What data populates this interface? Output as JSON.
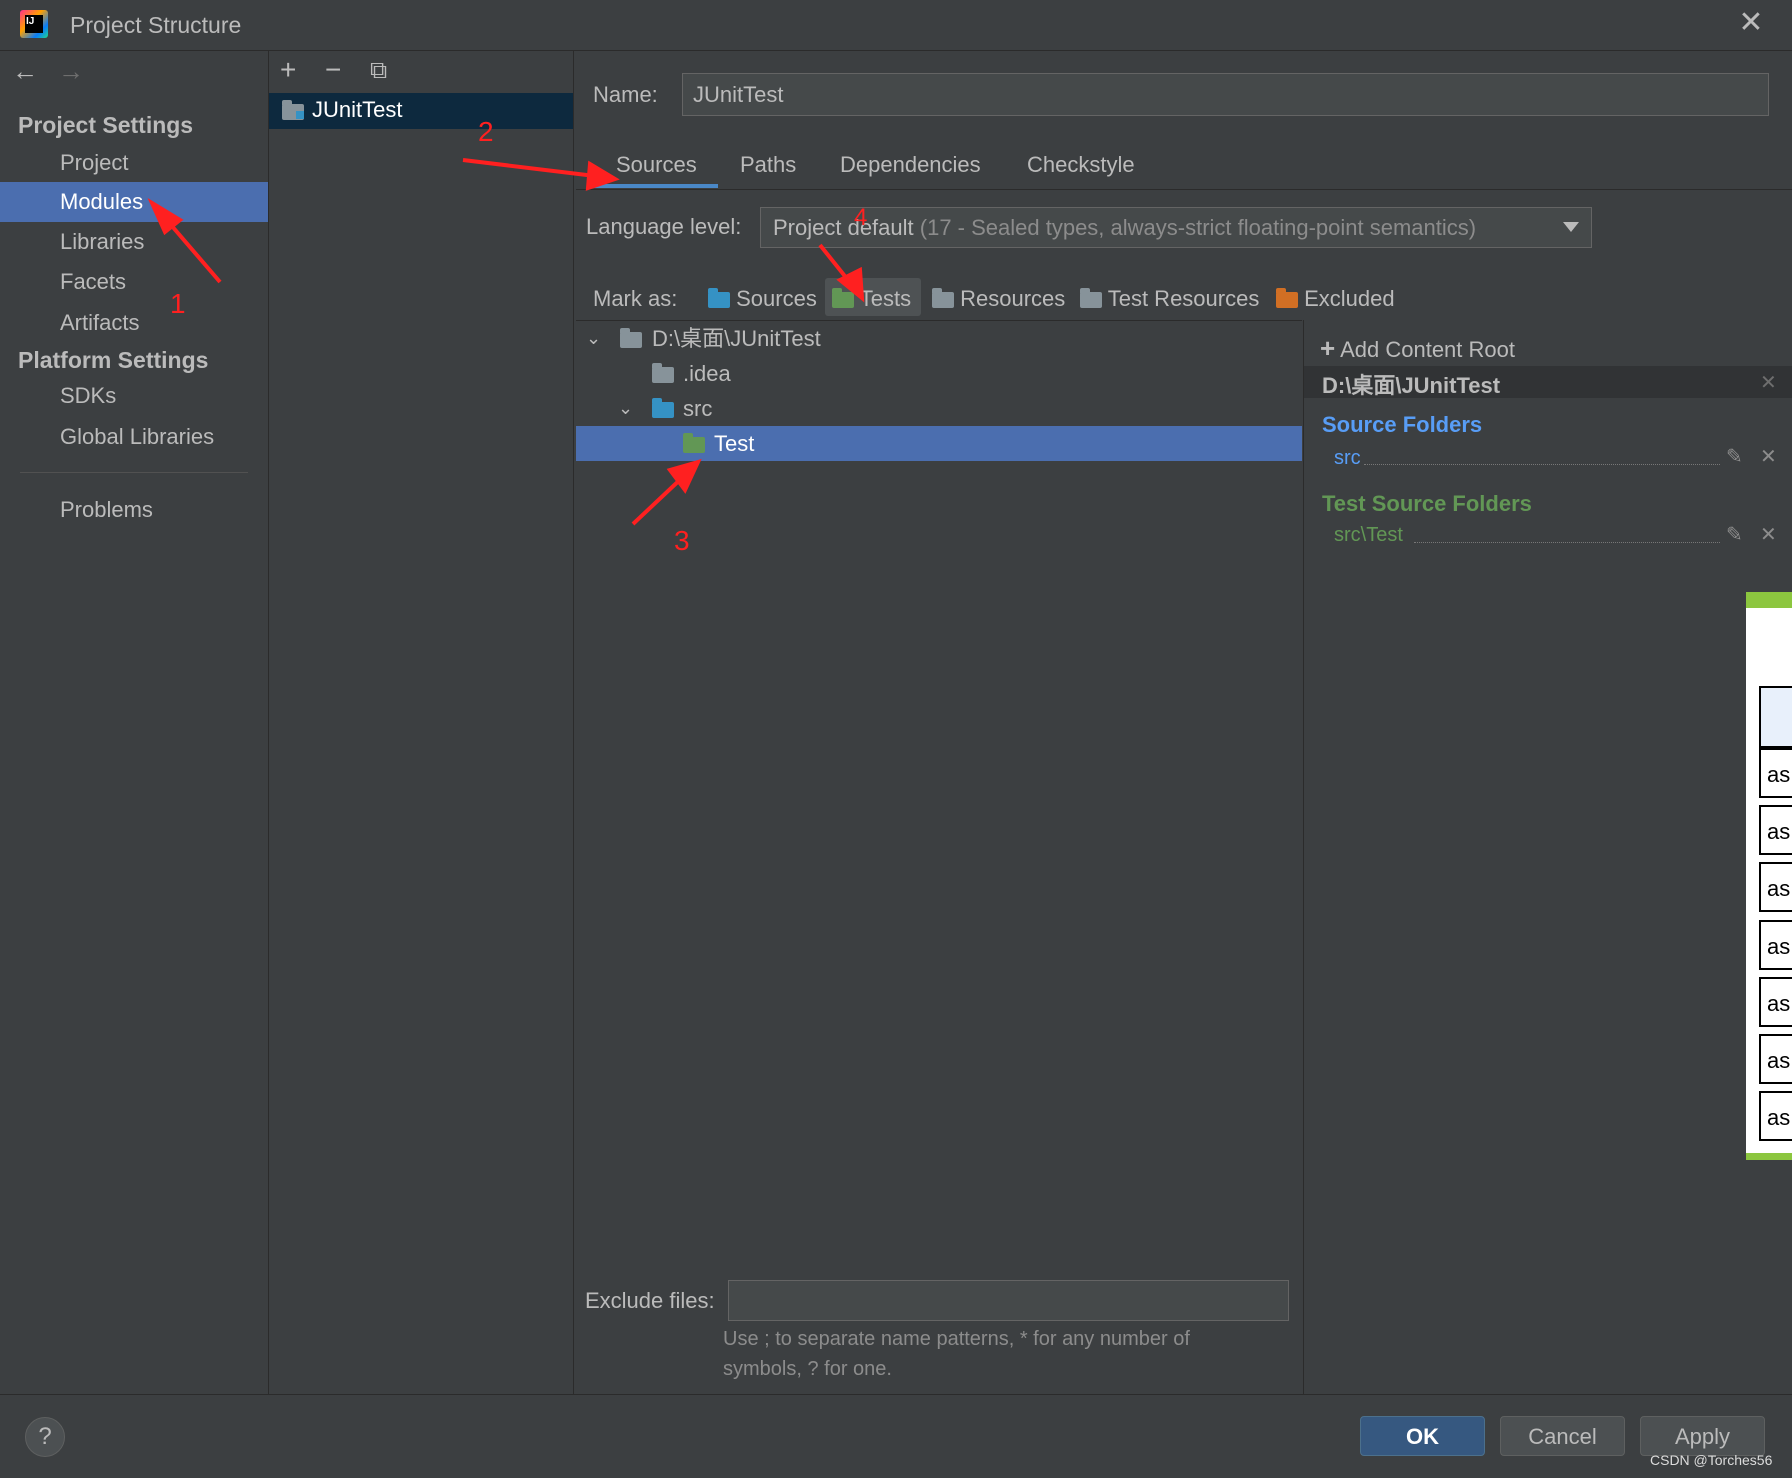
{
  "window": {
    "title": "Project Structure"
  },
  "nav": {
    "back": "←",
    "forward": "→",
    "project_settings": "Project Settings",
    "items_project": [
      "Project",
      "Modules",
      "Libraries",
      "Facets",
      "Artifacts"
    ],
    "platform_settings": "Platform Settings",
    "items_platform": [
      "SDKs",
      "Global Libraries"
    ],
    "problems": "Problems",
    "selected": "Modules"
  },
  "modules": {
    "tools": {
      "add": "+",
      "remove": "−",
      "copy": "⧉"
    },
    "list": [
      "JUnitTest"
    ]
  },
  "module": {
    "name_label": "Name:",
    "name_value": "JUnitTest",
    "tabs": [
      "Sources",
      "Paths",
      "Dependencies",
      "Checkstyle"
    ],
    "active_tab": "Sources",
    "language_label": "Language level:",
    "language_value": "Project default",
    "language_detail": "(17 - Sealed types, always-strict floating-point semantics)",
    "mark_as_label": "Mark as:",
    "mark_buttons": [
      "Sources",
      "Tests",
      "Resources",
      "Test Resources",
      "Excluded"
    ]
  },
  "tree": {
    "root": "D:\\桌面\\JUnitTest",
    "idea": ".idea",
    "src": "src",
    "test": "Test"
  },
  "content_root": {
    "add": "Add Content Root",
    "path": "D:\\桌面\\JUnitTest",
    "source_folders_title": "Source Folders",
    "source_folder": "src",
    "test_folders_title": "Test Source Folders",
    "test_folder": "src\\Test"
  },
  "exclude": {
    "label": "Exclude files:",
    "value": "",
    "hint_line1": "Use ; to separate name patterns, * for any number of",
    "hint_line2": "symbols, ? for one."
  },
  "footer": {
    "help": "?",
    "ok": "OK",
    "cancel": "Cancel",
    "apply": "Apply"
  },
  "annotations": [
    "1",
    "2",
    "3",
    "4"
  ],
  "overlay_cells": [
    "as",
    "as",
    "as",
    "as",
    "as",
    "as",
    "as"
  ],
  "watermark": "CSDN @Torches56",
  "colors": {
    "selection": "#4b6eaf",
    "accent": "#4a88c7",
    "test_green": "#629755",
    "source_blue": "#589df6",
    "annotation": "#ff2020"
  }
}
